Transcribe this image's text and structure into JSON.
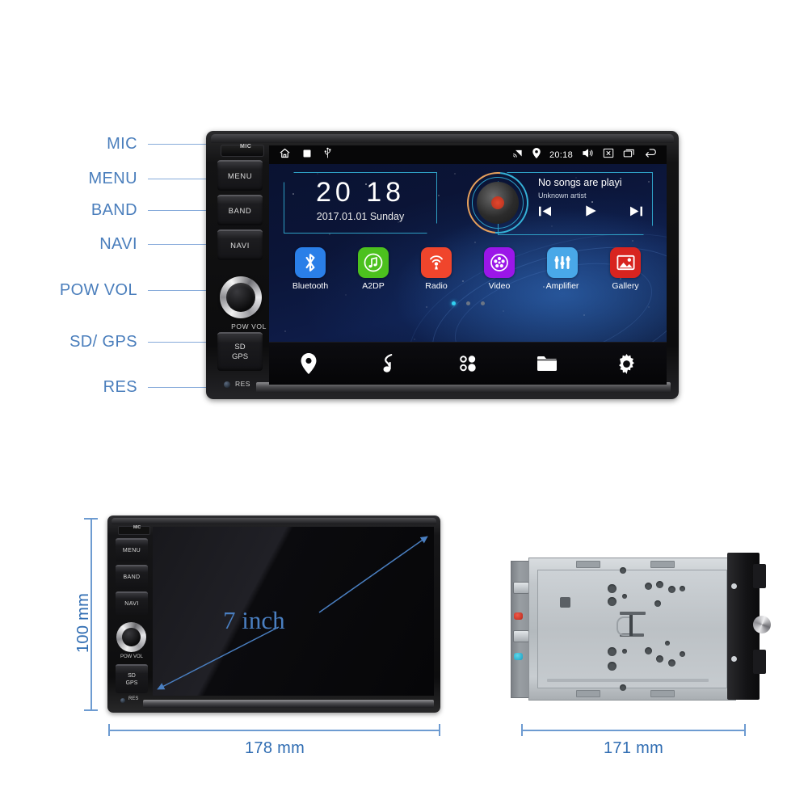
{
  "callouts": [
    {
      "label": "MIC",
      "name": "callout-mic"
    },
    {
      "label": "MENU",
      "name": "callout-menu"
    },
    {
      "label": "BAND",
      "name": "callout-band"
    },
    {
      "label": "NAVI",
      "name": "callout-navi"
    },
    {
      "label": "POW VOL",
      "name": "callout-pow-vol"
    },
    {
      "label": "SD/ GPS",
      "name": "callout-sd-gps"
    },
    {
      "label": "RES",
      "name": "callout-res"
    }
  ],
  "unit": {
    "mic_label": "MIC",
    "buttons": [
      "MENU",
      "BAND",
      "NAVI"
    ],
    "knob_label": "POW  VOL",
    "sd_label_line1": "SD",
    "sd_label_line2": "GPS",
    "res_label": "RES"
  },
  "screen": {
    "statusbar": {
      "left_icons": [
        "home-icon",
        "stop-square-icon",
        "usb-icon"
      ],
      "right_icons": [
        "cast-icon",
        "location-pin-icon"
      ],
      "time": "20:18",
      "trailing_icons": [
        "volume-icon",
        "close-box-icon",
        "recent-apps-icon",
        "back-arrow-icon"
      ]
    },
    "clock_widget": {
      "hours": "20",
      "minutes": "18",
      "date": "2017.01.01 Sunday"
    },
    "music_widget": {
      "title": "No songs are playi",
      "artist": "Unknown artist",
      "controls": [
        "previous-icon",
        "play-icon",
        "next-icon"
      ]
    },
    "apps": [
      {
        "label": "Bluetooth",
        "icon": "bluetooth-icon",
        "color": "#2a7fe8"
      },
      {
        "label": "A2DP",
        "icon": "music-note-icon",
        "color": "#4cc11e"
      },
      {
        "label": "Radio",
        "icon": "radio-icon",
        "color": "#f0452c"
      },
      {
        "label": "Video",
        "icon": "film-reel-icon",
        "color": "#9b16e8"
      },
      {
        "label": "Amplifier",
        "icon": "equalizer-icon",
        "color": "#49a8e8"
      },
      {
        "label": "Gallery",
        "icon": "photo-icon",
        "color": "#d8241f"
      }
    ],
    "page_dots": {
      "count": 3,
      "active_index": 0,
      "active_color": "#32d2f2"
    },
    "dock": [
      {
        "icon": "location-pin-icon",
        "name": "dock-navigation"
      },
      {
        "icon": "music-note-icon",
        "name": "dock-music"
      },
      {
        "icon": "apps-grid-icon",
        "name": "dock-apps"
      },
      {
        "icon": "folder-icon",
        "name": "dock-files"
      },
      {
        "icon": "gear-icon",
        "name": "dock-settings"
      }
    ]
  },
  "dimensions": {
    "height": "100 mm",
    "width": "178 mm",
    "depth": "171 mm",
    "screen_size": "7 inch",
    "line_color": "#6d9bd1",
    "text_color": "#2f6cb2"
  },
  "unit2": {
    "mic_label": "MIC",
    "buttons": [
      "MENU",
      "BAND",
      "NAVI"
    ],
    "knob_label": "POW  VOL",
    "sd_label_line1": "SD",
    "sd_label_line2": "GPS",
    "res_label": "RES"
  }
}
